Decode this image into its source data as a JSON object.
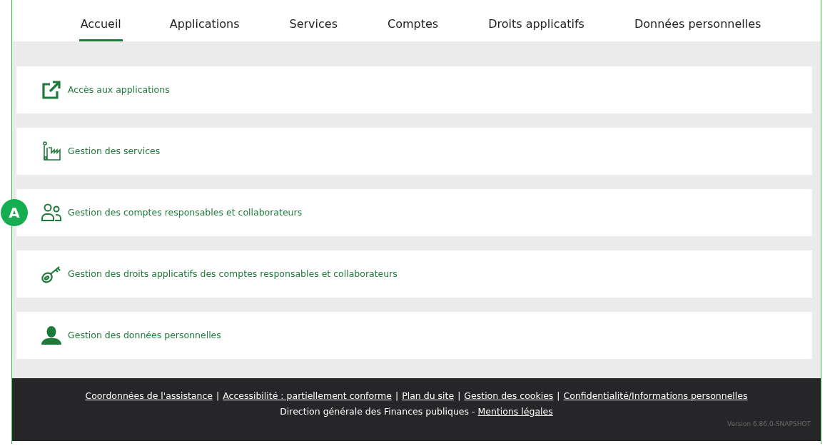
{
  "tabs": [
    {
      "label": "Accueil",
      "selected": true
    },
    {
      "label": "Applications",
      "selected": false
    },
    {
      "label": "Services",
      "selected": false
    },
    {
      "label": "Comptes",
      "selected": false
    },
    {
      "label": "Droits applicatifs",
      "selected": false
    },
    {
      "label": "Données personnelles",
      "selected": false
    }
  ],
  "cards": [
    {
      "kind": "external",
      "label": "Accès aux applications"
    },
    {
      "kind": "factory",
      "label": "Gestion des services"
    },
    {
      "kind": "users",
      "label": "Gestion des comptes responsables et collaborateurs",
      "badge": "A"
    },
    {
      "kind": "key",
      "label": "Gestion des droits applicatifs des comptes responsables et collaborateurs"
    },
    {
      "kind": "person",
      "label": "Gestion des données personnelles"
    }
  ],
  "footer": {
    "links": [
      "Coordonnées de l'assistance",
      "Accessibilité : partiellement conforme",
      "Plan du site",
      "Gestion des cookies",
      "Confidentialité/Informations personnelles"
    ],
    "separator": "|",
    "owner": "Direction générale des Finances publiques -",
    "legal_link": "Mentions légales",
    "version": "Version 6.86.0-SNAPSHOT"
  }
}
